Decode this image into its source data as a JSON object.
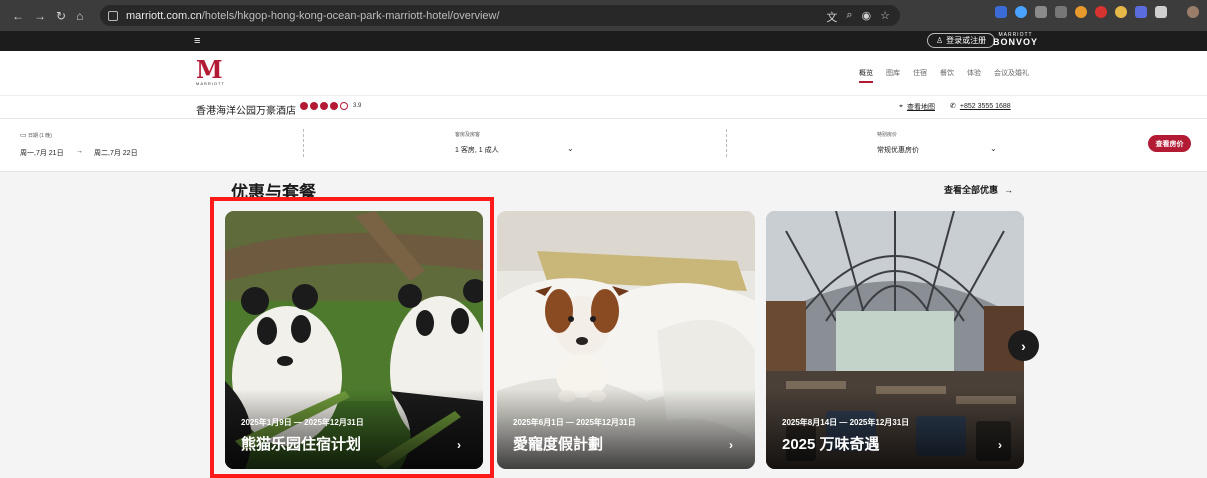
{
  "browser": {
    "url_domain": "marriott.com.cn",
    "url_path": "/hotels/hkgop-hong-kong-ocean-park-marriott-hotel/overview/"
  },
  "topbar": {
    "login_label": "登录或注册",
    "bonvoy_small": "MARRIOTT",
    "bonvoy_big": "BONVΟY"
  },
  "header": {
    "logo_word": "MARRIOTT",
    "nav": [
      "概览",
      "图库",
      "住宿",
      "餐饮",
      "体验",
      "会议及婚礼"
    ]
  },
  "hotel": {
    "name": "香港海洋公园万豪酒店",
    "rating_filled": 4,
    "rating_total": 5,
    "rating_score": "3.9",
    "map_label": "查看地图",
    "phone": "+852 3555 1688"
  },
  "booking": {
    "dates_label": "日期 (1 晚)",
    "check_in": "周一,7月 21日",
    "arrow": "→",
    "check_out": "周二,7月 22日",
    "rooms_label": "客房及房客",
    "rooms_value": "1 客房, 1 成人",
    "rate_label": "特别房价",
    "rate_value": "常规优惠房价",
    "check_rates": "查看房价"
  },
  "offers": {
    "title": "优惠与套餐",
    "see_all": "查看全部优惠",
    "cards": [
      {
        "dates": "2025年1月9日 — 2025年12月31日",
        "title": "熊猫乐园住宿计划"
      },
      {
        "dates": "2025年6月1日 — 2025年12月31日",
        "title": "愛寵度假計劃"
      },
      {
        "dates": "2025年8月14日 — 2025年12月31日",
        "title": "2025 万味奇遇"
      }
    ]
  },
  "colors": {
    "brand": "#b31b34",
    "highlight": "#ff1a1a"
  }
}
